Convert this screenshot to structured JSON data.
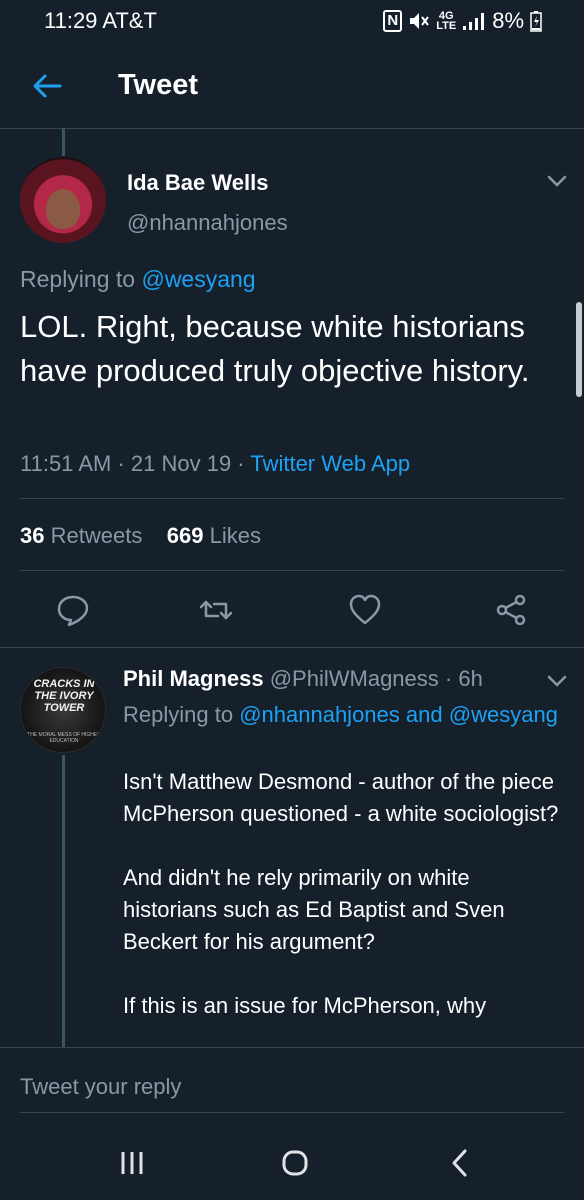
{
  "status_bar": {
    "time_carrier": "11:29 AT&T",
    "nfc": "N",
    "network": "4G",
    "network_sub": "LTE",
    "battery": "8%"
  },
  "header": {
    "title": "Tweet",
    "accent_color": "#1da1f2"
  },
  "tweet": {
    "author_name": "Ida Bae Wells",
    "author_handle": "@nhannahjones",
    "replying_prefix": "Replying to",
    "replying_to": "@wesyang",
    "text": "LOL. Right, because white historians have produced truly objective history.",
    "time": "11:51 AM",
    "date": "21 Nov 19",
    "source": "Twitter Web App",
    "retweet_count": "36",
    "retweet_label": "Retweets",
    "like_count": "669",
    "like_label": "Likes"
  },
  "reply": {
    "avatar_cover_title": "CRACKS IN THE IVORY TOWER",
    "avatar_cover_subtitle": "THE MORAL MESS OF HIGHER EDUCATION",
    "author_name": "Phil Magness",
    "author_handle": "@PhilWMagness",
    "age": "6h",
    "replying_prefix": "Replying to",
    "replying_to_1": "@nhannahjones",
    "replying_and": "and",
    "replying_to_2": "@wesyang",
    "paragraphs": [
      "Isn't Matthew Desmond - author of the piece McPherson questioned - a white sociologist?",
      "And didn't he rely primarily on white historians such as Ed Baptist and Sven Beckert for his argument?",
      "If this is an issue for McPherson, why"
    ]
  },
  "composer": {
    "placeholder": "Tweet your reply"
  },
  "icons": {
    "back": "arrow-left-icon",
    "reply": "comment-icon",
    "retweet": "retweet-icon",
    "like": "heart-icon",
    "share": "share-icon",
    "menu": "chevron-down-icon"
  }
}
